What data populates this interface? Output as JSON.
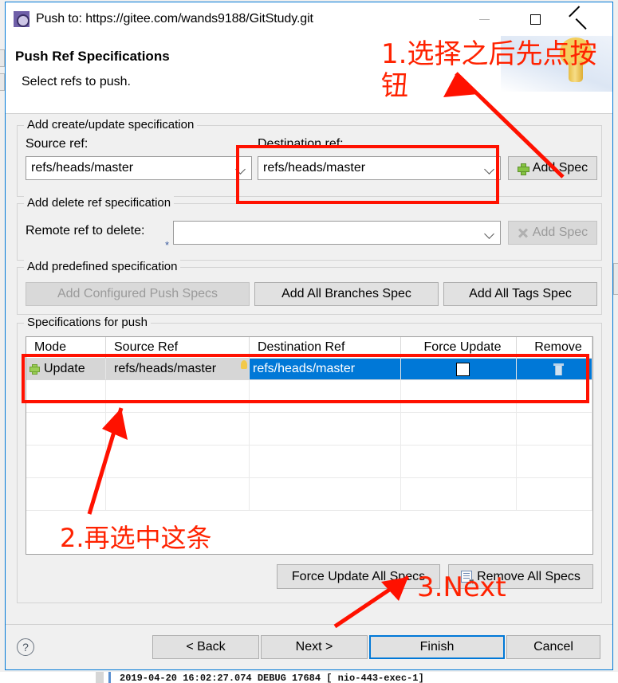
{
  "window": {
    "title": "Push to: https://gitee.com/wands9188/GitStudy.git",
    "icon": "git-push-icon",
    "controls": {
      "minimize": "minimize-icon",
      "maximize": "maximize-icon",
      "close": "close-icon"
    }
  },
  "header": {
    "title": "Push Ref Specifications",
    "subtitle": "Select refs to push."
  },
  "create_group": {
    "legend": "Add create/update specification",
    "source_label": "Source ref:",
    "source_value": "refs/heads/master",
    "destination_label": "Destination ref:",
    "destination_value": "refs/heads/master",
    "add_spec_label": "Add Spec"
  },
  "delete_group": {
    "legend": "Add delete ref specification",
    "remote_label": "Remote ref to delete:",
    "remote_value": "",
    "required_marker": "*",
    "add_spec_label": "Add Spec"
  },
  "predefined_group": {
    "legend": "Add predefined specification",
    "buttons": [
      {
        "label": "Add Configured Push Specs",
        "enabled": false
      },
      {
        "label": "Add All Branches Spec",
        "enabled": true
      },
      {
        "label": "Add All Tags Spec",
        "enabled": true
      }
    ]
  },
  "specs_group": {
    "legend": "Specifications for push",
    "columns": [
      "Mode",
      "Source Ref",
      "Destination Ref",
      "Force Update",
      "Remove"
    ],
    "rows": [
      {
        "mode": "Update",
        "source_ref": "refs/heads/master",
        "destination_ref": "refs/heads/master",
        "force_update": false,
        "remove_icon": "trash-icon",
        "selected": true
      }
    ],
    "empty_row_count": 4,
    "force_update_all_label": "Force Update All Specs",
    "remove_all_label": "Remove All Specs"
  },
  "footer": {
    "help": "?",
    "back": "< Back",
    "next": "Next >",
    "finish": "Finish",
    "cancel": "Cancel"
  },
  "annotations": [
    {
      "id": "step1",
      "text": "1.选择之后先点按\n钮"
    },
    {
      "id": "step2",
      "text": "2.再选中这条"
    },
    {
      "id": "step3",
      "text": "3.Next"
    }
  ],
  "background": {
    "log_line": "2019-04-20 16:02:27.074 DEBUG 17684   [ nio-443-exec-1]"
  },
  "colors": {
    "accent": "#0078d7",
    "annotation": "#ff2200",
    "selection": "#0078d7",
    "plus_icon": "#86c442"
  }
}
